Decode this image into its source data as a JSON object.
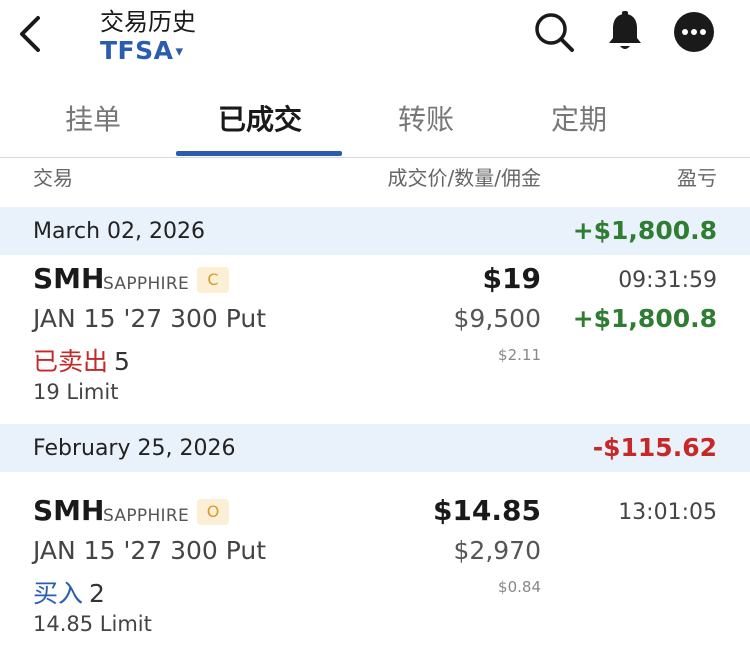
{
  "header": {
    "title": "交易历史",
    "account": "TFSA",
    "account_caret": "▾"
  },
  "tabs": [
    {
      "label": "挂单",
      "active": false
    },
    {
      "label": "已成交",
      "active": true
    },
    {
      "label": "转账",
      "active": false
    },
    {
      "label": "定期",
      "active": false
    }
  ],
  "columns": {
    "trade": "交易",
    "price_qty_commission": "成交价/数量/佣金",
    "pl": "盈亏"
  },
  "groups": [
    {
      "date": "March 02, 2026",
      "total": "+$1,800.8",
      "trades": [
        {
          "symbol": "SMH",
          "venue": "SAPPHIRE",
          "badge": "C",
          "contract": "JAN 15 '27 300 Put",
          "side": "已卖出",
          "quantity": "5",
          "order_type": "19 Limit",
          "price": "$19",
          "amount": "$9,500",
          "commission": "$2.11",
          "time": "09:31:59",
          "pl": "+$1,800.8"
        }
      ]
    },
    {
      "date": "February 25, 2026",
      "total": "-$115.62",
      "trades": [
        {
          "symbol": "SMH",
          "venue": "SAPPHIRE",
          "badge": "O",
          "contract": "JAN 15 '27 300 Put",
          "side": "买入",
          "quantity": "2",
          "order_type": "14.85 Limit",
          "price": "$14.85",
          "amount": "$2,970",
          "commission": "$0.84",
          "time": "13:01:05",
          "pl": ""
        }
      ]
    }
  ],
  "colors": {
    "accent": "#2a5cb0",
    "gain": "#2e7d32",
    "loss": "#c62828",
    "group_bg": "#e9f1fa"
  },
  "icons": [
    "back-arrow-icon",
    "search-icon",
    "bell-icon",
    "more-icon"
  ]
}
